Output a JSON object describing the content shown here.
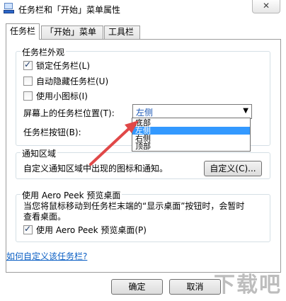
{
  "window": {
    "title": "任务栏和「开始」菜单属性",
    "close_glyph": "✕"
  },
  "tabs": [
    {
      "label": "任务栏",
      "active": true
    },
    {
      "label": "「开始」菜单",
      "active": false
    },
    {
      "label": "工具栏",
      "active": false
    }
  ],
  "appearance": {
    "group_label": "任务栏外观",
    "lock_label": "锁定任务栏(L)",
    "lock_checked": true,
    "autohide_label": "自动隐藏任务栏(U)",
    "autohide_checked": false,
    "small_icons_label": "使用小图标(I)",
    "small_icons_checked": false,
    "position_label": "屏幕上的任务栏位置(T):",
    "position_value": "左侧",
    "buttons_label": "任务栏按钮(B):",
    "position_options": [
      {
        "label": "底部",
        "highlighted": false
      },
      {
        "label": "左侧",
        "highlighted": true
      },
      {
        "label": "右侧",
        "highlighted": false
      },
      {
        "label": "顶部",
        "highlighted": false
      }
    ]
  },
  "notification": {
    "group_label": "通知区域",
    "description": "自定义通知区域中出现的图标和通知。",
    "customize_button": "自定义(C)..."
  },
  "aero_peek": {
    "group_label": "使用 Aero Peek 预览桌面",
    "description_line1": "当您将鼠标移动到任务栏末端的“显示桌面”按钮时，会暂时",
    "description_line2": "查看桌面。",
    "checkbox_label": "使用 Aero Peek 预览桌面(P)",
    "checkbox_checked": true
  },
  "help_link": "如何自定义该任务栏?",
  "footer": {
    "ok_label": "确定",
    "cancel_label": "取消"
  },
  "watermark": {
    "text": "下载吧"
  },
  "colors": {
    "link": "#0b5fc4",
    "highlight": "#3399ff",
    "annotation_arrow": "#e04848"
  },
  "icons": {
    "app": "taskbar-properties-icon",
    "check": "checkmark-icon",
    "dropdown": "chevron-down-icon"
  }
}
